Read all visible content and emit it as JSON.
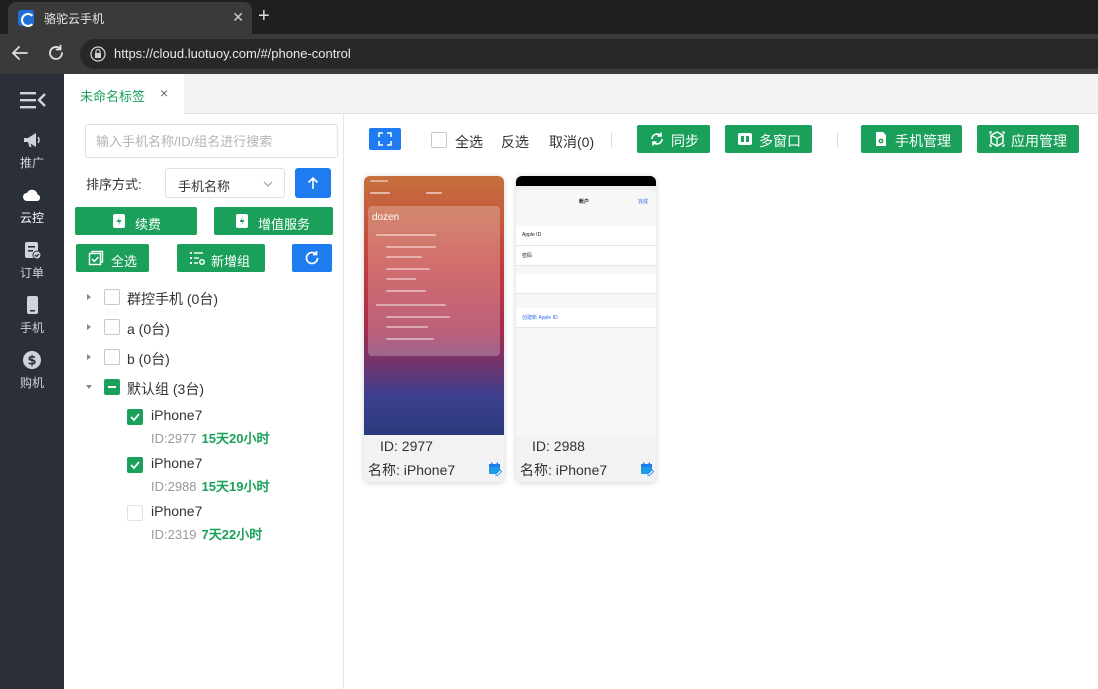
{
  "browser": {
    "tab_title": "骆驼云手机",
    "url": "https://cloud.luotuoy.com/#/phone-control"
  },
  "sidebar": {
    "items": [
      {
        "label": "推广",
        "icon": "megaphone-icon"
      },
      {
        "label": "云控",
        "icon": "cloud-icon",
        "active": true
      },
      {
        "label": "订单",
        "icon": "order-check-icon"
      },
      {
        "label": "手机",
        "icon": "phone-icon"
      },
      {
        "label": "购机",
        "icon": "dollar-icon"
      }
    ]
  },
  "page_tab": {
    "label": "未命名标签",
    "close": "×"
  },
  "group_panel": {
    "search_placeholder": "输入手机名称/ID/组名进行搜索",
    "sort_label": "排序方式:",
    "sort_value": "手机名称",
    "renew_label": "续费",
    "vas_label": "增值服务",
    "select_all_label": "全选",
    "new_group_label": "新增组",
    "groups": [
      {
        "label": "群控手机 (0台)",
        "expanded": false,
        "checked": "none"
      },
      {
        "label": "a (0台)",
        "expanded": false,
        "checked": "none"
      },
      {
        "label": "b (0台)",
        "expanded": false,
        "checked": "none"
      },
      {
        "label": "默认组 (3台)",
        "expanded": true,
        "checked": "partial"
      }
    ],
    "devices": [
      {
        "name": "iPhone7",
        "id": "ID:2977",
        "remaining": "15天20小时",
        "checked": true
      },
      {
        "name": "iPhone7",
        "id": "ID:2988",
        "remaining": "15天19小时",
        "checked": true
      },
      {
        "name": "iPhone7",
        "id": "ID:2319",
        "remaining": "7天22小时",
        "checked": false
      }
    ]
  },
  "toolbar": {
    "select_all": "全选",
    "invert": "反选",
    "cancel": "取消(0)",
    "sync": "同步",
    "multi_window": "多窗口",
    "phone_manage": "手机管理",
    "app_manage": "应用管理"
  },
  "cards": [
    {
      "id_text": "ID: 2977",
      "name_text": "名称: iPhone7",
      "screen_word": "dozen"
    },
    {
      "id_text": "ID: 2988",
      "name_text": "名称: iPhone7",
      "screen_title": "帐户",
      "screen_done": "完成",
      "screen_apple_id": "Apple ID",
      "screen_pwd": "密码",
      "screen_create": "创建新 Apple ID"
    }
  ],
  "colors": {
    "green": "#1aa05a",
    "blue": "#1e7cf0",
    "sidebar": "#2b3038"
  }
}
